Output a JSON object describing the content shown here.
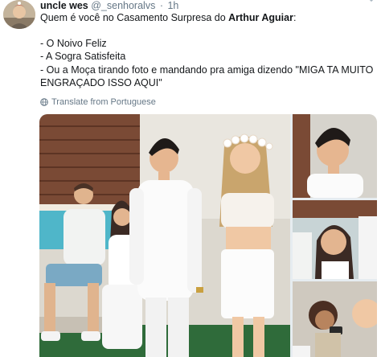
{
  "tweet": {
    "display_name": "uncle wes",
    "handle": "@_senhoralvs",
    "separator": "·",
    "time": "1h",
    "line1_prefix": "Quem é você no Casamento Surpresa do ",
    "line1_bold": "Arthur Aguiar",
    "line1_suffix": ":",
    "items": [
      "- O Noivo Feliz",
      "- A Sogra Satisfeita",
      "- Ou a Moça tirando foto e mandando pra amiga dizendo \"MIGA TA MUITO",
      "ENGRAÇADO ISSO AQUI\""
    ],
    "translate_label": "Translate from Portuguese"
  },
  "icons": {
    "avatar": "avatar",
    "caret": "chevron-down-icon",
    "globe": "globe-icon"
  },
  "colors": {
    "text": "#14171a",
    "secondary": "#657786",
    "caret": "#aab8c2",
    "background": "#ffffff"
  },
  "media": {
    "images": [
      "main-photo",
      "groom-closeup",
      "mother-closeup",
      "woman-photographing-closeup"
    ]
  }
}
